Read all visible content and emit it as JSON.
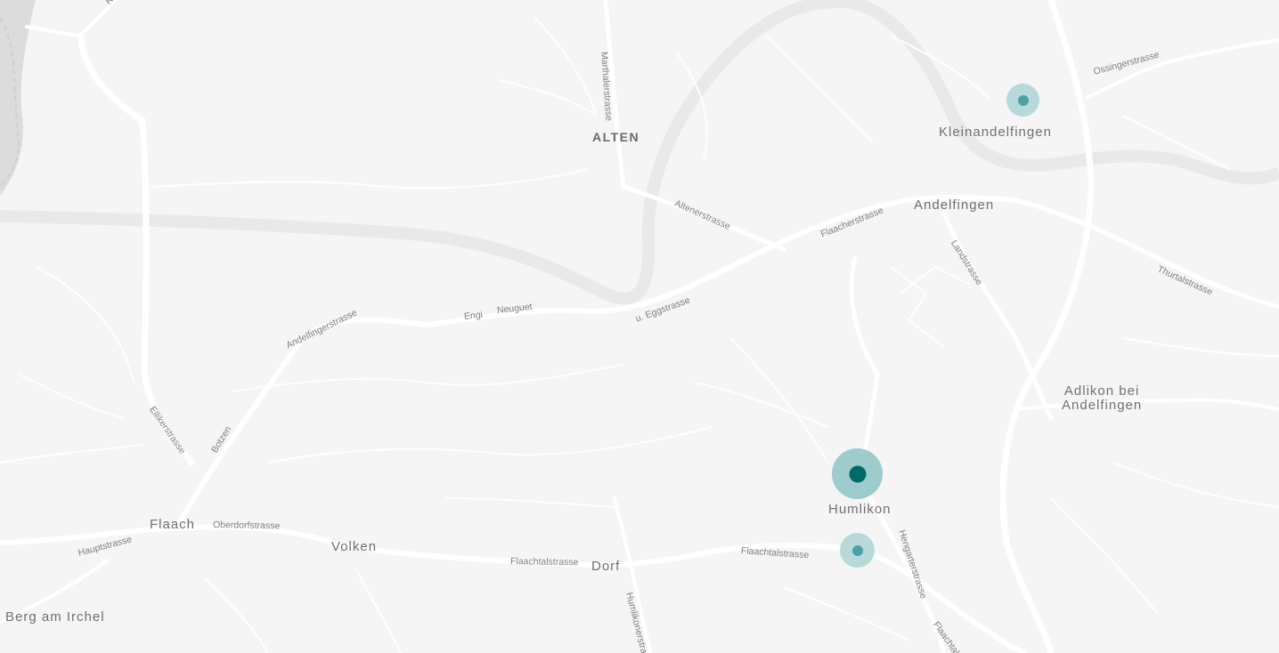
{
  "map": {
    "colors": {
      "background": "#f5f5f5",
      "road": "#ffffff",
      "river": "#e9e9e9",
      "label": "#707070",
      "marker_halo": "#9ecbcb",
      "marker_dot_primary": "#006a6a",
      "marker_dot_secondary": "#4aa3a3"
    },
    "places": {
      "alten": "ALTEN",
      "kleinandelfingen": "Kleinandelfingen",
      "andelfingen": "Andelfingen",
      "adlikon_line1": "Adlikon bei",
      "adlikon_line2": "Andelfingen",
      "humlikon": "Humlikon",
      "flaach": "Flaach",
      "volken": "Volken",
      "dorf": "Dorf",
      "berg": "Berg am Irchel"
    },
    "streets": {
      "marthalerstrasse": "Marthalerstrasse",
      "ossingerstrasse": "Ossingerstrasse",
      "altenerstrasse": "Altenerstrasse",
      "flaacherstrasse": "Flaacherstrasse",
      "landstrasse": "Landstrasse",
      "thurtalstrasse": "Thurtalstrasse",
      "andelfingerstrasse": "Andelfingerstrasse",
      "engi": "Engi",
      "neuguet": "Neuguet",
      "eggstrasse": "u. Eggstrasse",
      "ellikerstrasse": "Ellikerstrasse",
      "botzen": "Botzen",
      "hauptstrasse": "Hauptstrasse",
      "oberdorfstrasse": "Oberdorfstrasse",
      "flaachtalstrasse_west": "Flaachtalstrasse",
      "flaachtalstrasse_east": "Flaachtalstrasse",
      "flaachtalstrasse_south": "Flaachtalstr",
      "hengarterstrasse": "Hengarterstrasse",
      "humlikonerstrasse": "Humlikonerstrass",
      "top_left_fragment": "Ru"
    },
    "markers": [
      {
        "id": "kleinandelfingen",
        "type": "secondary"
      },
      {
        "id": "humlikon",
        "type": "primary"
      },
      {
        "id": "humlikon-south",
        "type": "secondary"
      }
    ]
  }
}
